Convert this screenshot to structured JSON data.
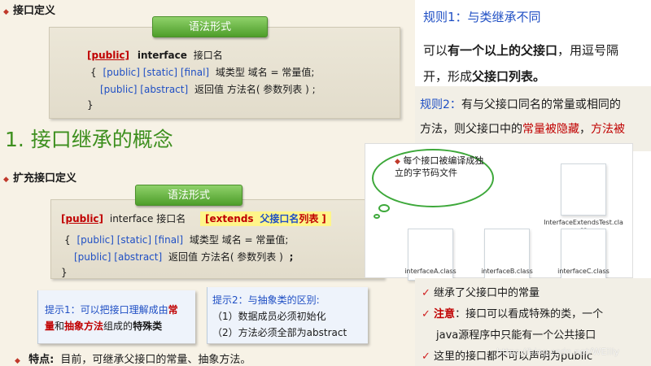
{
  "left": {
    "heading_def": "接口定义",
    "syntax_label_1": "语法形式",
    "code1": {
      "l1_public": "[public]",
      "l1_interface": "interface",
      "l1_name": "接口名",
      "l2_brace": "{",
      "l2_mods": "[public] [static] [final]",
      "l2_rest": "域类型  域名 = 常量值;",
      "l3_mods": "[public] [abstract]",
      "l3_rest": "返回值 方法名( 参数列表 )  ;",
      "l4_brace": "}"
    },
    "title": "1. 接口继承的概念",
    "heading_ext": "扩充接口定义",
    "syntax_label_2": "语法形式",
    "code2": {
      "l1_public": "[public]",
      "l1_rest": "interface  接口名",
      "l1_ext_open": "[extends",
      "l1_ext_name": "父接口名",
      "l1_ext_list": "列表",
      "l1_ext_close": "]",
      "l2_brace": "{",
      "l2_mods": "[public] [static] [final]",
      "l2_rest": "域类型  域名 = 常量值;",
      "l3_mods": "[public] [abstract]",
      "l3_rest": "返回值 方法名( 参数列表 )",
      "l3_semi": ";",
      "l4_brace": "}"
    },
    "tip1": {
      "prefix": "提示1：可以把接口理解成由",
      "const1": "常",
      "const2": "量",
      "and": "和",
      "abstract": "抽象方法",
      "mid": "组成的",
      "special": "特殊类"
    },
    "tip2": {
      "title": "提示2：与抽象类的区别:",
      "item1": "（1）数据成员必须初始化",
      "item2": "（2）方法必须全部为abstract"
    },
    "feature_label": "特点:",
    "feature_text": "目前，可继承父接口的常量、抽象方法。"
  },
  "right": {
    "rule1_title": "规则1：与类继承不同",
    "rule1_a": "可以",
    "rule1_b": "有一个以上的父接口",
    "rule1_c": "，用逗号隔",
    "rule1_d": "开，形成",
    "rule1_e": "父接口列表。",
    "rule2_title": "规则2：",
    "rule2_a": "有与父接口同名的常量或相同的",
    "rule2_b": "方法，则父接口中的",
    "rule2_c": "常量被隐藏",
    "rule2_d": "，",
    "rule2_e": "方法被",
    "cloud_text": "每个接口被编译成独立的字节码文件",
    "files": [
      "InterfaceExtendsTest.class",
      "interfaceA.class",
      "interfaceB.class",
      "interfaceC.class"
    ],
    "check1": "继承了父接口中的常量",
    "check2_label": "注意",
    "check2_text": "：接口可以看成特殊的类，一个",
    "check2_cont": "java源程序中只能有一个公共接口",
    "check3": "这里的接口都不可以声明为public",
    "watermark": "https://blog.csdn.net/WEilly"
  }
}
